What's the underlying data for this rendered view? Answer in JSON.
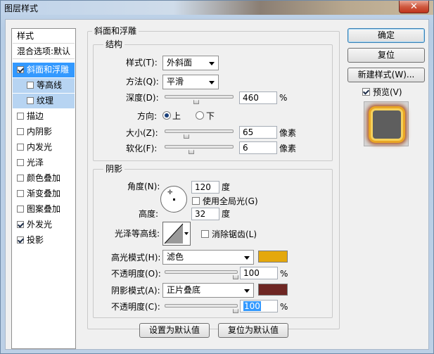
{
  "window": {
    "title": "图层样式",
    "close": "✕"
  },
  "styles_list": {
    "header": "样式",
    "blend": "混合选项:默认",
    "items": [
      {
        "label": "斜面和浮雕",
        "checked": true
      },
      {
        "label": "等高线",
        "checked": false
      },
      {
        "label": "纹理",
        "checked": false
      },
      {
        "label": "描边",
        "checked": false
      },
      {
        "label": "内阴影",
        "checked": false
      },
      {
        "label": "内发光",
        "checked": false
      },
      {
        "label": "光泽",
        "checked": false
      },
      {
        "label": "颜色叠加",
        "checked": false
      },
      {
        "label": "渐变叠加",
        "checked": false
      },
      {
        "label": "图案叠加",
        "checked": false
      },
      {
        "label": "外发光",
        "checked": true
      },
      {
        "label": "投影",
        "checked": true
      }
    ]
  },
  "bevel": {
    "section_title": "斜面和浮雕",
    "structure_title": "结构",
    "style_label": "样式(T):",
    "style_value": "外斜面",
    "technique_label": "方法(Q):",
    "technique_value": "平滑",
    "depth_label": "深度(D):",
    "depth_value": "460",
    "depth_unit": "%",
    "depth_fraction": 0.45,
    "direction_label": "方向:",
    "dir_up": "上",
    "dir_down": "下",
    "size_label": "大小(Z):",
    "size_value": "65",
    "size_unit": "像素",
    "size_fraction": 0.3,
    "soften_label": "软化(F):",
    "soften_value": "6",
    "soften_unit": "像素",
    "soften_fraction": 0.37
  },
  "shading": {
    "title": "阴影",
    "angle_label": "角度(N):",
    "angle_value": "120",
    "angle_unit": "度",
    "global_light_label": "使用全局光(G)",
    "altitude_label": "高度:",
    "altitude_value": "32",
    "altitude_unit": "度",
    "gloss_label": "光泽等高线:",
    "antialias_label": "消除锯齿(L)",
    "highlight_mode_label": "高光模式(H):",
    "highlight_mode_value": "滤色",
    "highlight_color": "#e4a80c",
    "hl_opacity_label": "不透明度(O):",
    "hl_opacity_value": "100",
    "hl_opacity_unit": "%",
    "shadow_mode_label": "阴影模式(A):",
    "shadow_mode_value": "正片叠底",
    "shadow_color": "#6e2623",
    "sh_opacity_label": "不透明度(C):",
    "sh_opacity_value": "100",
    "sh_opacity_unit": "%"
  },
  "footer": {
    "make_default": "设置为默认值",
    "reset_default": "复位为默认值"
  },
  "right": {
    "ok": "确定",
    "reset": "复位",
    "new_style": "新建样式(W)...",
    "preview_label": "预览(V)"
  }
}
